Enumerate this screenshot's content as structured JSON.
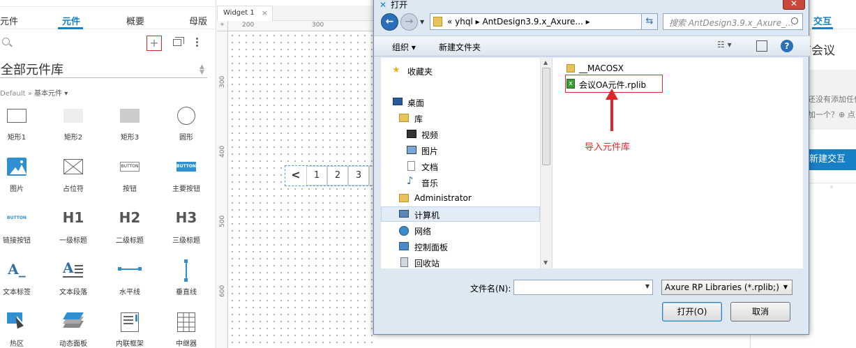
{
  "left_panel": {
    "tabs": [
      "元件",
      "元件",
      "概要",
      "母版"
    ],
    "active_tab": "元件",
    "library_name": "全部元件库",
    "breadcrumb_lib": "Default",
    "breadcrumb_sep": " » ",
    "breadcrumb_cat": "基本元件 ▾",
    "add_symbol": "+",
    "widgets": [
      {
        "label": "矩形1",
        "icon": "rect-outline-icon"
      },
      {
        "label": "矩形2",
        "icon": "rect-light-icon"
      },
      {
        "label": "矩形3",
        "icon": "rect-gray-icon"
      },
      {
        "label": "圆形",
        "icon": "circle-icon"
      },
      {
        "label": "图片",
        "icon": "image-icon"
      },
      {
        "label": "占位符",
        "icon": "placeholder-icon"
      },
      {
        "label": "按钮",
        "icon": "button-icon",
        "text": "BUTTON"
      },
      {
        "label": "主要按钮",
        "icon": "primary-button-icon",
        "text": "BUTTON"
      },
      {
        "label": "链接按钮",
        "icon": "link-button-icon",
        "text": "BUTTON"
      },
      {
        "label": "一级标题",
        "icon": "h1-icon",
        "text": "H1"
      },
      {
        "label": "二级标题",
        "icon": "h2-icon",
        "text": "H2"
      },
      {
        "label": "三级标题",
        "icon": "h3-icon",
        "text": "H3"
      },
      {
        "label": "文本标签",
        "icon": "text-label-icon",
        "text": "A_"
      },
      {
        "label": "文本段落",
        "icon": "paragraph-icon",
        "text": "A"
      },
      {
        "label": "水平线",
        "icon": "hline-icon"
      },
      {
        "label": "垂直线",
        "icon": "vline-icon"
      },
      {
        "label": "热区",
        "icon": "hotspot-icon"
      },
      {
        "label": "动态面板",
        "icon": "dynamic-panel-icon"
      },
      {
        "label": "内联框架",
        "icon": "inline-frame-icon"
      },
      {
        "label": "中继器",
        "icon": "repeater-icon"
      }
    ]
  },
  "canvas": {
    "tab_label": "Widget 1",
    "tab_close": "×",
    "ruler_h": [
      "200",
      "300"
    ],
    "ruler_v": [
      "300",
      "400",
      "500",
      "600"
    ],
    "pager": [
      "<",
      "1",
      "2",
      "3"
    ]
  },
  "right_panel": {
    "tab": "交互",
    "title_fragment": "有会议",
    "text1": "还没有添加任何",
    "text2": "加一个？⊕ 点",
    "new_interaction": "新建交互",
    "plus": "+"
  },
  "dialog": {
    "title": "打开",
    "close": "✕",
    "path": "«  yhql  ▸  AntDesign3.9.x_Axure...  ▸",
    "search_placeholder": "搜索 AntDesign3.9.x_Axure_...",
    "toolbar": {
      "organize": "组织 ▾",
      "new_folder": "新建文件夹",
      "help": "?"
    },
    "nav_items": [
      {
        "label": "收藏夹",
        "icon": "star-icon"
      },
      {
        "label": "桌面",
        "icon": "desktop-icon"
      },
      {
        "label": "库",
        "icon": "library-icon"
      },
      {
        "label": "视频",
        "icon": "video-icon"
      },
      {
        "label": "图片",
        "icon": "picture-icon"
      },
      {
        "label": "文档",
        "icon": "document-icon"
      },
      {
        "label": "音乐",
        "icon": "music-icon"
      },
      {
        "label": "Administrator",
        "icon": "user-folder-icon"
      },
      {
        "label": "计算机",
        "icon": "computer-icon"
      },
      {
        "label": "网络",
        "icon": "network-icon"
      },
      {
        "label": "控制面板",
        "icon": "control-panel-icon"
      },
      {
        "label": "回收站",
        "icon": "recycle-bin-icon"
      }
    ],
    "files": [
      {
        "name": "__MACOSX",
        "icon": "folder-icon"
      },
      {
        "name": "会议OA元件.rplib",
        "icon": "rplib-file-icon"
      }
    ],
    "annotation": "导入元件库",
    "filename_label": "文件名(N):",
    "filename_value": "",
    "filetype": "Axure RP Libraries (*.rplib;)",
    "open_button": "打开(O)",
    "cancel_button": "取消"
  }
}
